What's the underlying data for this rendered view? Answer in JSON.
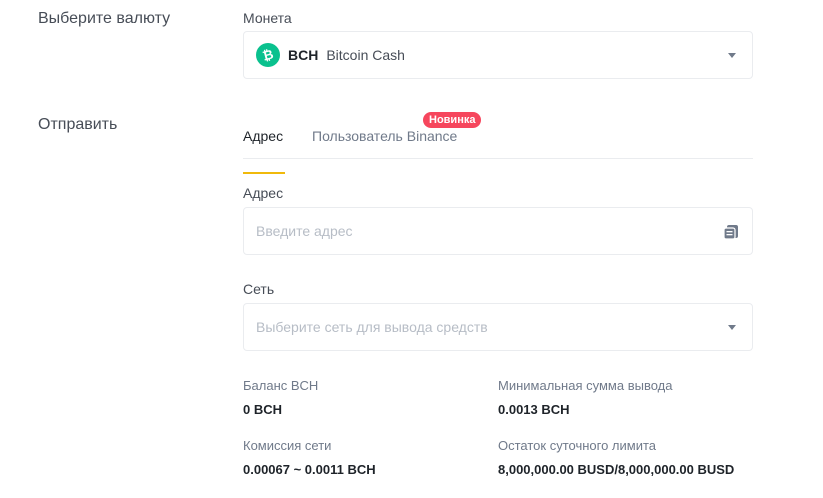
{
  "currency_section": {
    "label": "Выберите валюту",
    "field_label": "Монета",
    "selected_coin": {
      "symbol": "BCH",
      "name": "Bitcoin Cash",
      "icon": "bitcoin-cash-icon",
      "icon_color": "#0ac18e"
    }
  },
  "send_section": {
    "label": "Отправить",
    "tabs": [
      {
        "label": "Адрес",
        "active": true
      },
      {
        "label": "Пользователь Binance",
        "active": false,
        "badge": "Новинка"
      }
    ],
    "address": {
      "label": "Адрес",
      "placeholder": "Введите адрес",
      "icon": "paste-icon"
    },
    "network": {
      "label": "Сеть",
      "placeholder": "Выберите сеть для вывода средств"
    }
  },
  "info": {
    "balance": {
      "label": "Баланс BCH",
      "value": "0 BCH"
    },
    "min_withdrawal": {
      "label": "Минимальная сумма вывода",
      "value": "0.0013 BCH"
    },
    "network_fee": {
      "label": "Комиссия сети",
      "value": "0.00067 ~ 0.0011 BCH"
    },
    "daily_limit": {
      "label": "Остаток суточного лимита",
      "value": "8,000,000.00 BUSD/8,000,000.00 BUSD"
    }
  },
  "colors": {
    "accent": "#f0b90b",
    "badge": "#f6465d",
    "coin": "#0ac18e"
  }
}
